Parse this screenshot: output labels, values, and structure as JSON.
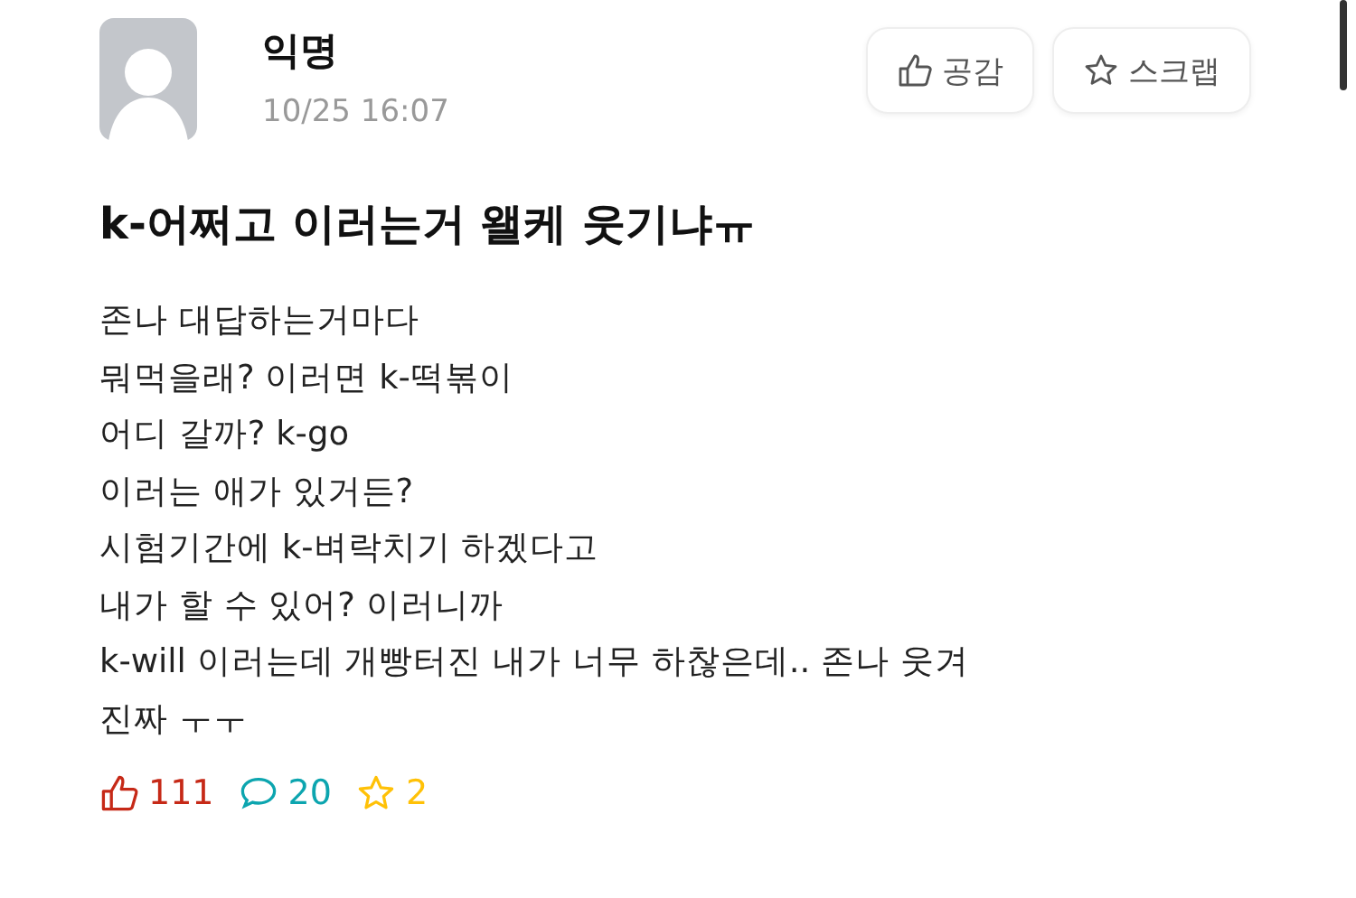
{
  "post": {
    "author": "익명",
    "time": "10/25 16:07",
    "actions": [
      {
        "kind": "like",
        "label": "공감"
      },
      {
        "kind": "scrap",
        "label": "스크랩"
      }
    ],
    "title": "k-어쩌고 이러는거 왤케 웃기냐ㅠ",
    "lines": [
      "존나 대답하는거마다",
      "뭐먹을래? 이러면 k-떡볶이",
      "어디 갈까? k-go",
      "이러는 애가 있거든?",
      "시험기간에 k-벼락치기 하겠다고",
      "내가 할 수 있어? 이러니까",
      "k-will 이러는데 개빵터진 내가 너무 하찮은데.. 존나 웃겨",
      "진짜 ㅜㅜ"
    ],
    "stats": [
      {
        "kind": "like",
        "count": "111",
        "color": "#c62917"
      },
      {
        "kind": "comment",
        "count": "20",
        "color": "#0ca5af"
      },
      {
        "kind": "scrap",
        "count": "2",
        "color": "#ffc107"
      }
    ]
  }
}
